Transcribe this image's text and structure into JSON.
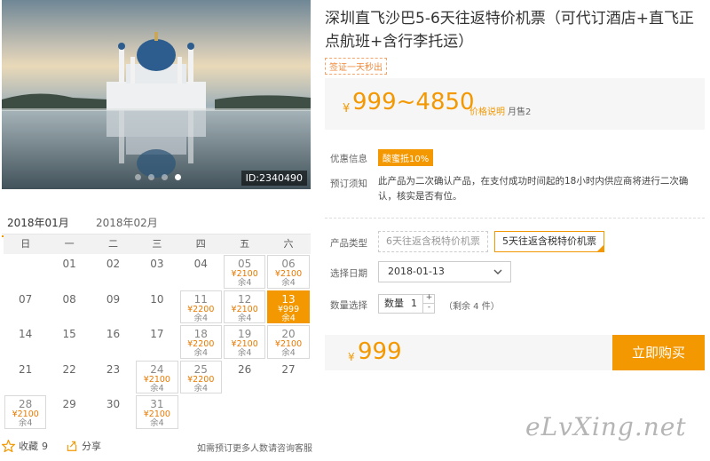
{
  "photo": {
    "id_label": "ID:2340490",
    "slide_count": 4,
    "active_slide": 3
  },
  "calendar": {
    "months": [
      "2018年01月",
      "2018年02月"
    ],
    "active_month": 0,
    "weekdays": [
      "日",
      "一",
      "二",
      "三",
      "四",
      "五",
      "六"
    ],
    "cells": [
      {
        "day": ""
      },
      {
        "day": "01"
      },
      {
        "day": "02"
      },
      {
        "day": "03"
      },
      {
        "day": "04"
      },
      {
        "day": "05",
        "price": "¥2100",
        "left": "余4"
      },
      {
        "day": "06",
        "price": "¥2100",
        "left": "余4"
      },
      {
        "day": "07"
      },
      {
        "day": "08"
      },
      {
        "day": "09"
      },
      {
        "day": "10"
      },
      {
        "day": "11",
        "price": "¥2200",
        "left": "余4"
      },
      {
        "day": "12",
        "price": "¥2100",
        "left": "余4"
      },
      {
        "day": "13",
        "price": "¥999",
        "left": "余4",
        "selected": true
      },
      {
        "day": "14"
      },
      {
        "day": "15"
      },
      {
        "day": "16"
      },
      {
        "day": "17"
      },
      {
        "day": "18",
        "price": "¥2200",
        "left": "余4"
      },
      {
        "day": "19",
        "price": "¥2100",
        "left": "余4"
      },
      {
        "day": "20",
        "price": "¥2100",
        "left": "余4"
      },
      {
        "day": "21"
      },
      {
        "day": "22"
      },
      {
        "day": "23"
      },
      {
        "day": "24",
        "price": "¥2100",
        "left": "余4"
      },
      {
        "day": "25",
        "price": "¥2200",
        "left": "余4"
      },
      {
        "day": "26"
      },
      {
        "day": "27"
      },
      {
        "day": "28",
        "price": "¥2100",
        "left": "余4"
      },
      {
        "day": "29"
      },
      {
        "day": "30"
      },
      {
        "day": "31",
        "price": "¥2100",
        "left": "余4"
      }
    ]
  },
  "footer": {
    "fav_label": "收藏",
    "fav_count": "9",
    "share_label": "分享",
    "consult": "如需预订更多人数请咨询客服"
  },
  "product": {
    "title": "深圳直飞沙巴5-6天往返特价机票（可代订酒店+直飞正点航班+含行李托运）",
    "visa_tag": "签证一天秒出",
    "price_yen": "¥",
    "price_range": "999~4850",
    "price_note": "价格说明",
    "sold": "月售2",
    "promo_label": "优惠信息",
    "promo_badge": "酸蜜抵10%",
    "notice_label": "预订须知",
    "notice_text": "此产品为二次确认产品，在支付成功时间起的18小时内供应商将进行二次确认，核实是否有位。",
    "type_label": "产品类型",
    "types": [
      "6天往返含税特价机票",
      "5天往返含税特价机票"
    ],
    "date_label": "选择日期",
    "date_value": "2018-01-13",
    "qty_label": "数量选择",
    "qty_prefix": "数量",
    "qty_value": "1",
    "stock": "（剩余 4 件）",
    "total_yen": "¥",
    "total": "999",
    "buy_label": "立即购买"
  },
  "watermark": "eLvXing.net",
  "colors": {
    "accent": "#f39800"
  }
}
